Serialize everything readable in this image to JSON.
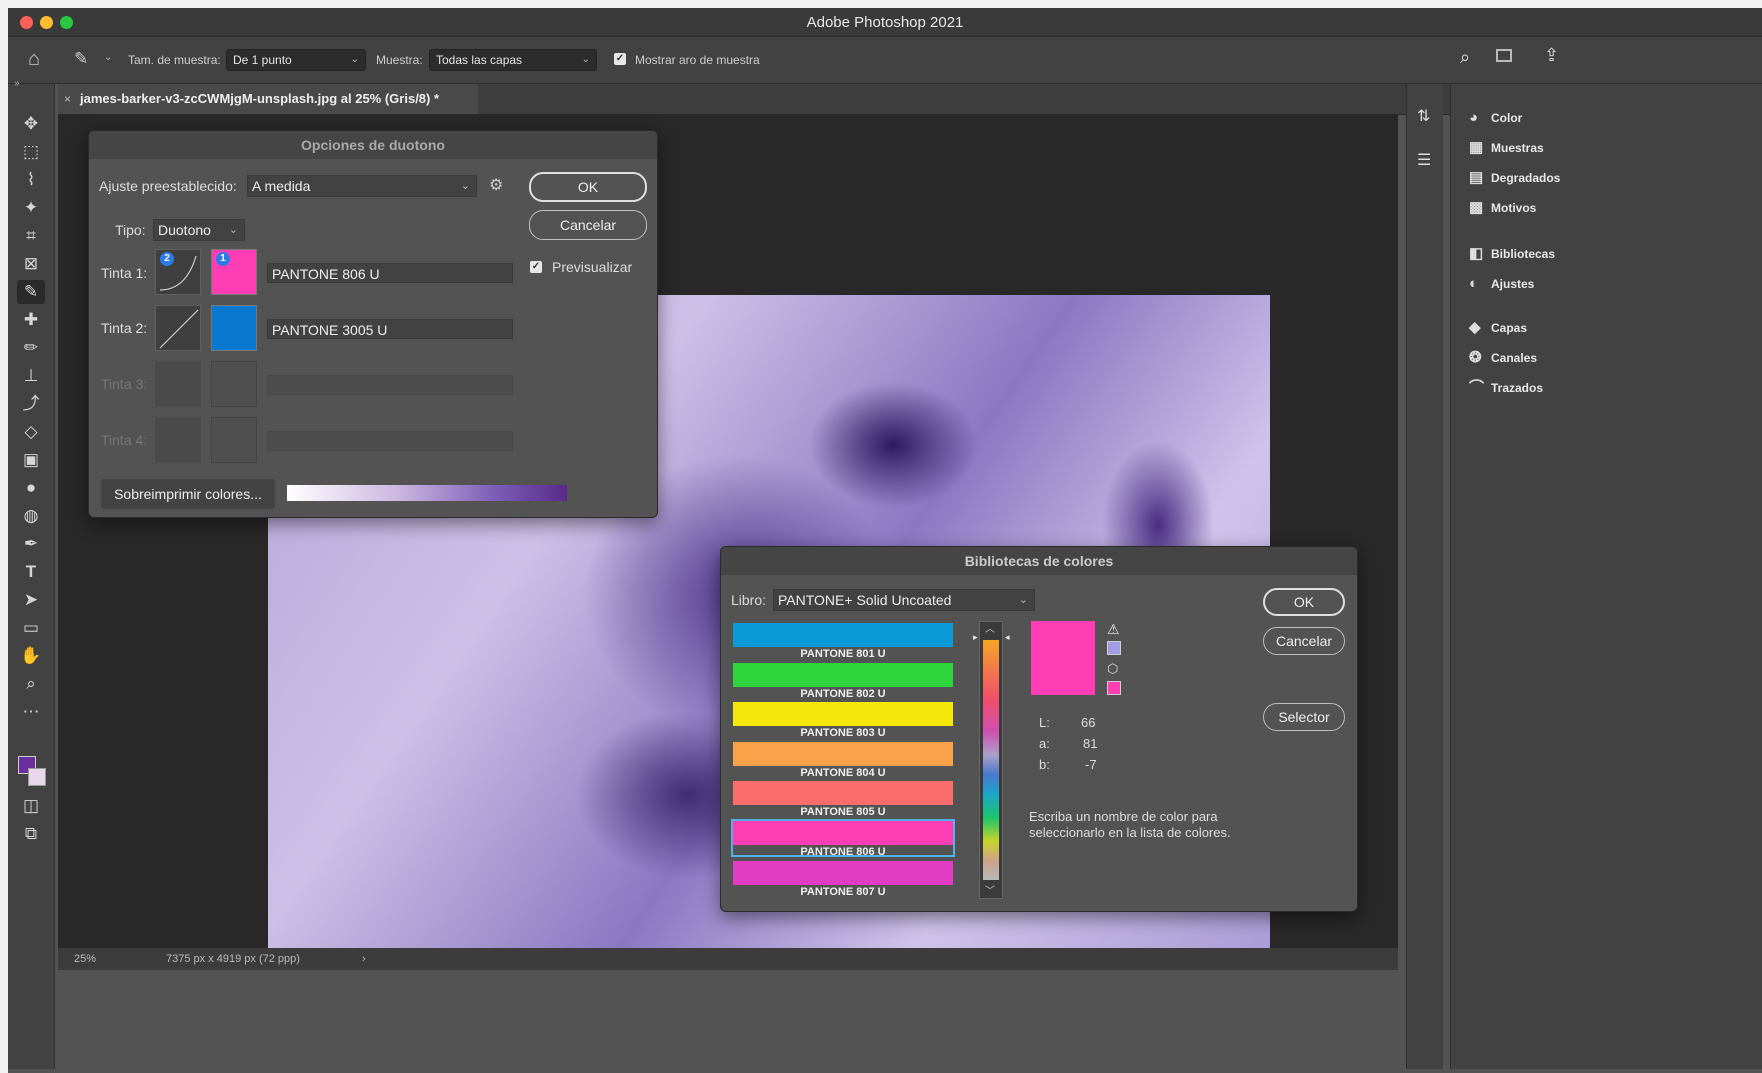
{
  "window": {
    "title": "Adobe Photoshop 2021"
  },
  "options": {
    "sample_size_label": "Tam. de muestra:",
    "sample_size_value": "De 1 punto",
    "sample_label": "Muestra:",
    "sample_value": "Todas las capas",
    "show_ring_label": "Mostrar aro de muestra"
  },
  "document": {
    "tab_title": "james-barker-v3-zcCWMjgM-unsplash.jpg al 25% (Gris/8) *"
  },
  "status": {
    "zoom": "25%",
    "info": "7375 px x 4919 px (72 ppp)"
  },
  "panels": [
    "Color",
    "Muestras",
    "Degradados",
    "Motivos",
    "Bibliotecas",
    "Ajustes",
    "Capas",
    "Canales",
    "Trazados"
  ],
  "duotone": {
    "title": "Opciones de duotono",
    "preset_label": "Ajuste preestablecido:",
    "preset_value": "A medida",
    "type_label": "Tipo:",
    "type_value": "Duotono",
    "ok": "OK",
    "cancel": "Cancelar",
    "preview": "Previsualizar",
    "inks": [
      {
        "label": "Tinta 1:",
        "name": "PANTONE 806 U",
        "color": "#ff3eb5"
      },
      {
        "label": "Tinta 2:",
        "name": "PANTONE 3005 U",
        "color": "#0b78d0"
      },
      {
        "label": "Tinta 3:",
        "name": "",
        "color": ""
      },
      {
        "label": "Tinta 4:",
        "name": "",
        "color": ""
      }
    ],
    "badge1": "2",
    "badge2": "1",
    "overprint": "Sobreimprimir colores..."
  },
  "library": {
    "title": "Bibliotecas de colores",
    "book_label": "Libro:",
    "book_value": "PANTONE+ Solid Uncoated",
    "ok": "OK",
    "cancel": "Cancelar",
    "picker": "Selector",
    "swatches": [
      {
        "name": "PANTONE 801 U",
        "color": "#0a9ad8"
      },
      {
        "name": "PANTONE 802 U",
        "color": "#2ed43c"
      },
      {
        "name": "PANTONE 803 U",
        "color": "#f7e80c"
      },
      {
        "name": "PANTONE 804 U",
        "color": "#f9a24a"
      },
      {
        "name": "PANTONE 805 U",
        "color": "#fb6d6d"
      },
      {
        "name": "PANTONE 806 U",
        "color": "#ff3eb5"
      },
      {
        "name": "PANTONE 807 U",
        "color": "#e23cc4"
      }
    ],
    "selected_index": 5,
    "preview_color": "#ff3eb5",
    "lab": {
      "L_label": "L:",
      "L": "66",
      "a_label": "a:",
      "a": "81",
      "b_label": "b:",
      "b": "-7"
    },
    "hint": "Escriba un nombre de color para seleccionarlo en la lista de colores."
  }
}
